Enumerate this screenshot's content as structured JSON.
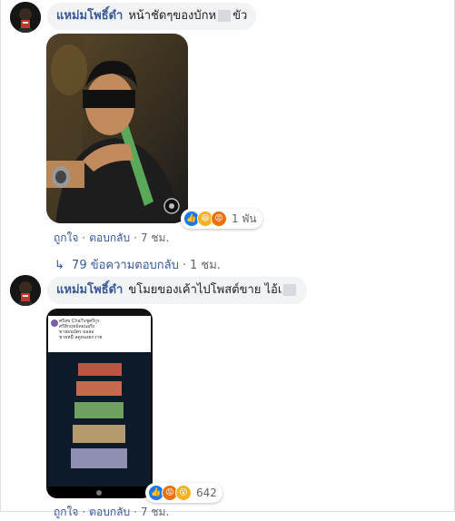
{
  "comment1": {
    "author": "แหม่มโพธิ์ดำ",
    "text_before": "หน้าชัดๆของบักห",
    "text_after": "ขัว",
    "reaction_count": "1 พัน",
    "like_label": "ถูกใจ",
    "reply_label": "ตอบกลับ",
    "time": "7 ชม.",
    "reaction_icons": [
      "like-icon",
      "haha-icon",
      "angry-icon"
    ]
  },
  "replies": {
    "label": "79 ข้อความตอบกลับ",
    "time": "1 ชม."
  },
  "comment2": {
    "author": "แหม่มโพธิ์ดำ",
    "text": "ขโมยของเค้าไปโพสต์ขาย ไอ้เ",
    "reaction_count": "642",
    "like_label": "ถูกใจ",
    "reply_label": "ตอบกลับ",
    "time": "7 ชม.",
    "reaction_icons": [
      "like-icon",
      "angry-icon",
      "wow-icon"
    ],
    "screenshot": {
      "post_title": "ศรีสุข ChaTvชูศรีกูร",
      "post_sub": "ศรีสิกฤทธ์คอนอรีง",
      "post_line2": "ขายธนบัตร ผลสอ",
      "post_line3": "ขายหมื่ ลดูทองยกวาช"
    }
  }
}
